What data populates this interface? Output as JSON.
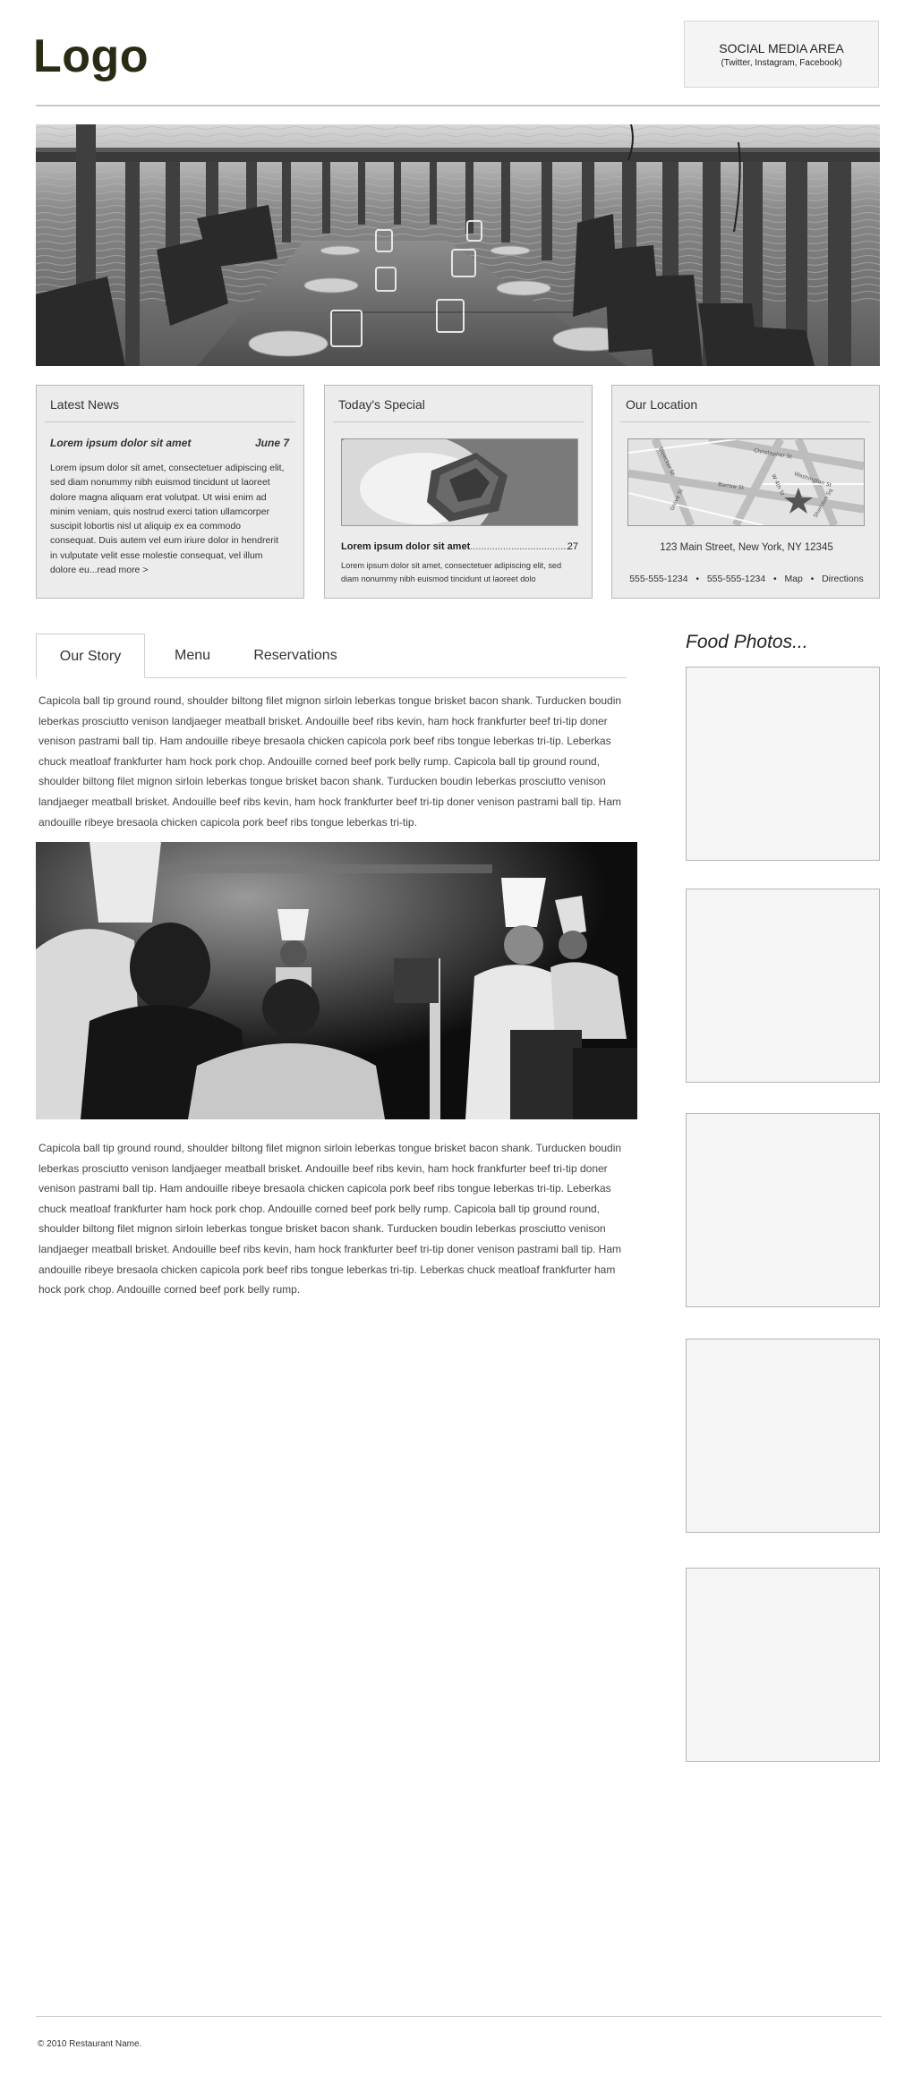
{
  "header": {
    "logo": "Logo",
    "social_title": "SOCIAL MEDIA AREA",
    "social_sub": "(Twitter, Instagram, Facebook)"
  },
  "news": {
    "heading": "Latest News",
    "title": "Lorem ipsum dolor sit amet",
    "date": "June 7",
    "body": "Lorem ipsum dolor sit amet, consectetuer adipiscing elit, sed diam nonummy nibh euismod tincidunt ut laoreet dolore magna aliquam erat volutpat. Ut wisi enim ad minim veniam, quis nostrud exerci tation ullamcorper suscipit lobortis nisl ut aliquip ex ea commodo consequat. Duis autem vel eum iriure dolor in hendrerit in vulputate velit esse molestie consequat, vel illum dolore eu...",
    "read_more": "read more >"
  },
  "special": {
    "heading": "Today's Special",
    "name": "Lorem ipsum dolor sit amet",
    "dots": "..............................................................",
    "price": "27",
    "desc": "Lorem ipsum dolor sit amet, consectetuer adipiscing elit, sed diam nonummy nibh euismod tincidunt ut laoreet dolo"
  },
  "location": {
    "heading": "Our Location",
    "address": "123 Main Street, New York, NY 12345",
    "phone1": "555-555-1234",
    "phone2": "555-555-1234",
    "map_link": "Map",
    "directions_link": "Directions",
    "separator": "•",
    "streets": [
      "Washington St",
      "Barrow St",
      "W 4th St",
      "Bleecker St",
      "Grove St",
      "Christopher St",
      "Sheridan Sq"
    ]
  },
  "tabs": [
    "Our Story",
    "Menu",
    "Reservations"
  ],
  "story": {
    "para1": "Capicola ball tip ground round, shoulder biltong filet mignon sirloin leberkas tongue brisket bacon shank. Turducken boudin leberkas prosciutto venison landjaeger meatball brisket. Andouille beef ribs kevin, ham hock frankfurter beef tri-tip doner venison pastrami ball tip. Ham andouille ribeye bresaola chicken capicola pork beef ribs tongue leberkas tri-tip. Leberkas chuck meatloaf frankfurter ham hock pork chop. Andouille corned beef pork belly rump. Capicola ball tip ground round, shoulder biltong filet mignon sirloin leberkas tongue brisket bacon shank. Turducken boudin leberkas prosciutto venison landjaeger meatball brisket. Andouille beef ribs kevin, ham hock frankfurter beef tri-tip doner venison pastrami ball tip. Ham andouille ribeye bresaola chicken capicola pork beef ribs tongue leberkas tri-tip.",
    "para2": "Capicola ball tip ground round, shoulder biltong filet mignon sirloin leberkas tongue brisket bacon shank. Turducken boudin leberkas prosciutto venison landjaeger meatball brisket. Andouille beef ribs kevin, ham hock frankfurter beef tri-tip doner venison pastrami ball tip. Ham andouille ribeye bresaola chicken capicola pork beef ribs tongue leberkas tri-tip. Leberkas chuck meatloaf frankfurter ham hock pork chop. Andouille corned beef pork belly rump. Capicola ball tip ground round, shoulder biltong filet mignon sirloin leberkas tongue brisket bacon shank. Turducken boudin leberkas prosciutto venison landjaeger meatball brisket. Andouille beef ribs kevin, ham hock frankfurter beef tri-tip doner venison pastrami ball tip. Ham andouille ribeye bresaola chicken capicola pork beef ribs tongue leberkas tri-tip. Leberkas chuck meatloaf frankfurter ham hock pork chop. Andouille corned beef pork belly rump."
  },
  "food_photos": {
    "title": "Food Photos..."
  },
  "footer": {
    "copyright": "© 2010 Restaurant Name."
  }
}
